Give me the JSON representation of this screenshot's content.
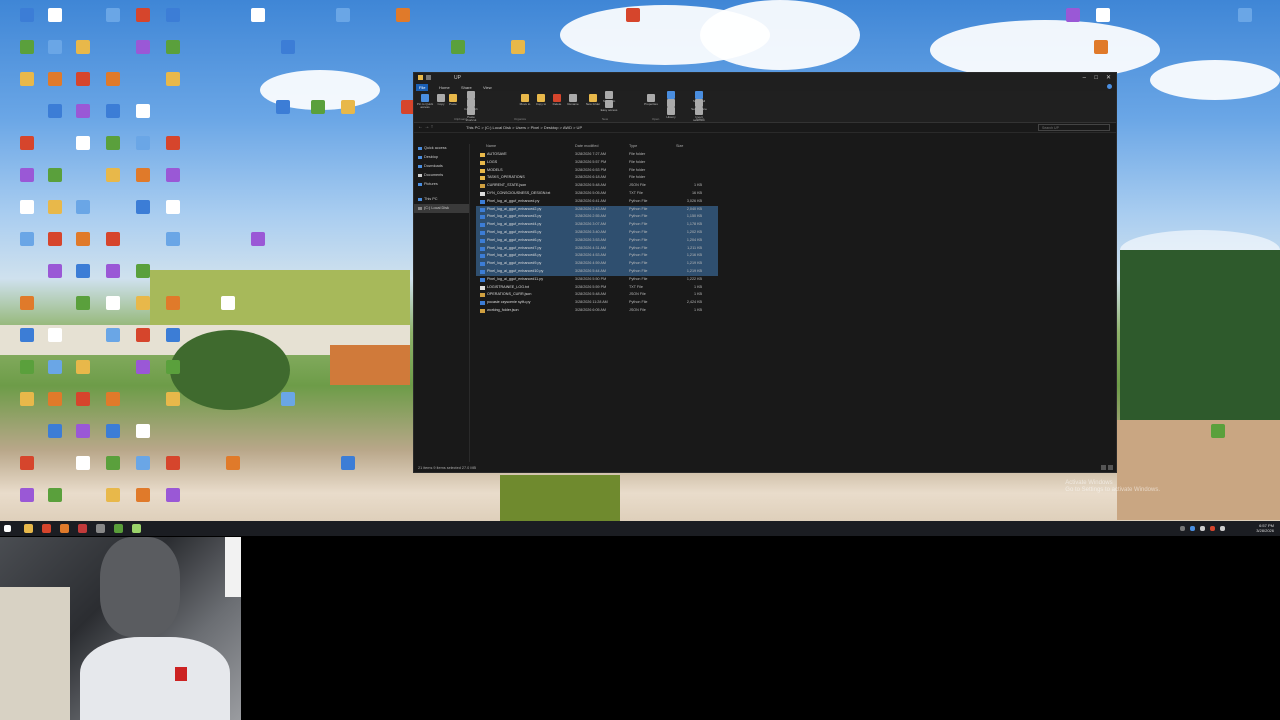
{
  "colors": {
    "explorer_bg": "#191919",
    "selection": "#2f4f6f",
    "ribbon_file_tab": "#1a5fb4",
    "folder": "#e8b84a",
    "python": "#3c7dd6",
    "text_file": "#dddddd",
    "json_file": "#d0a040",
    "taskbar": "#1b1d22"
  },
  "explorer": {
    "title": "UP",
    "tabs": [
      "File",
      "Home",
      "Share",
      "View"
    ],
    "ribbon": {
      "buttons": [
        {
          "label": "Pin to Quick access",
          "icon": "pin-icon"
        },
        {
          "label": "Copy",
          "icon": "copy-icon"
        },
        {
          "label": "Paste",
          "icon": "paste-icon"
        },
        {
          "label": "Cut",
          "icon": "cut-icon"
        },
        {
          "label": "Copy path",
          "icon": "path-icon"
        },
        {
          "label": "Paste shortcut",
          "icon": "shortcut-icon"
        },
        {
          "label": "Move to",
          "icon": "move-icon"
        },
        {
          "label": "Copy to",
          "icon": "copyto-icon"
        },
        {
          "label": "Delete",
          "icon": "delete-icon"
        },
        {
          "label": "Rename",
          "icon": "rename-icon"
        },
        {
          "label": "New folder",
          "icon": "newfolder-icon"
        },
        {
          "label": "New item",
          "icon": "newitem-icon"
        },
        {
          "label": "Easy access",
          "icon": "easyaccess-icon"
        },
        {
          "label": "Properties",
          "icon": "properties-icon"
        },
        {
          "label": "Open",
          "icon": "open-icon"
        },
        {
          "label": "Edit",
          "icon": "edit-icon"
        },
        {
          "label": "History",
          "icon": "history-icon"
        },
        {
          "label": "Select all",
          "icon": "selectall-icon"
        },
        {
          "label": "Select none",
          "icon": "selectnone-icon"
        },
        {
          "label": "Invert selection",
          "icon": "invert-icon"
        }
      ],
      "groups": [
        "Clipboard",
        "Organize",
        "New",
        "Open",
        "Select"
      ]
    },
    "address": {
      "crumbs": "This PC  >  (C:) Local Disk  >  Users  >  Pixel  >  Desktop  >  AWD  >  UP",
      "search_placeholder": "Search UP"
    },
    "nav_items": [
      {
        "label": "Quick access",
        "icon": "star-icon"
      },
      {
        "label": "Desktop",
        "icon": "desktop-icon"
      },
      {
        "label": "Downloads",
        "icon": "download-icon"
      },
      {
        "label": "Documents",
        "icon": "document-icon"
      },
      {
        "label": "Pictures",
        "icon": "picture-icon"
      },
      {
        "label": "This PC",
        "icon": "pc-icon"
      },
      {
        "label": "(C:) Local Disk",
        "icon": "disk-icon"
      }
    ],
    "columns": {
      "name": "Name",
      "date": "Date modified",
      "type": "Type",
      "size": "Size"
    },
    "files": [
      {
        "name": "AUTOSAVE",
        "date": "3/28/2026 7:27 AM",
        "type": "File folder",
        "size": "",
        "kind": "folder",
        "selected": false
      },
      {
        "name": "LOGS",
        "date": "3/28/2026 5:57 PM",
        "type": "File folder",
        "size": "",
        "kind": "folder",
        "selected": false
      },
      {
        "name": "MODELS",
        "date": "3/28/2026 6:53 PM",
        "type": "File folder",
        "size": "",
        "kind": "folder",
        "selected": false
      },
      {
        "name": "TASKS_OPERATIONS",
        "date": "3/28/2026 6:18 AM",
        "type": "File folder",
        "size": "",
        "kind": "folder",
        "selected": false
      },
      {
        "name": "CURRENT_STATE.json",
        "date": "3/28/2026 5:48 AM",
        "type": "JSON File",
        "size": "1 KB",
        "kind": "json",
        "selected": false
      },
      {
        "name": "DYN_CONSCIOUSNESS_DESIGN.txt",
        "date": "3/28/2026 5:05 AM",
        "type": "TXT File",
        "size": "16 KB",
        "kind": "txt",
        "selected": false
      },
      {
        "name": "Pixel_log_ai_gguf_enhanced.py",
        "date": "3/28/2026 6:41 AM",
        "type": "Python File",
        "size": "3,026 KB",
        "kind": "py",
        "selected": false
      },
      {
        "name": "Pixel_log_ai_gguf_enhanced2.py",
        "date": "3/28/2026 2:43 AM",
        "type": "Python File",
        "size": "2,040 KB",
        "kind": "py",
        "selected": true
      },
      {
        "name": "Pixel_log_ai_gguf_enhanced3.py",
        "date": "3/28/2026 2:55 AM",
        "type": "Python File",
        "size": "1,150 KB",
        "kind": "py",
        "selected": true
      },
      {
        "name": "Pixel_log_ai_gguf_enhanced4.py",
        "date": "3/28/2026 3:07 AM",
        "type": "Python File",
        "size": "1,178 KB",
        "kind": "py",
        "selected": true
      },
      {
        "name": "Pixel_log_ai_gguf_enhanced5.py",
        "date": "3/28/2026 3:40 AM",
        "type": "Python File",
        "size": "1,202 KB",
        "kind": "py",
        "selected": true
      },
      {
        "name": "Pixel_log_ai_gguf_enhanced6.py",
        "date": "3/28/2026 3:53 AM",
        "type": "Python File",
        "size": "1,204 KB",
        "kind": "py",
        "selected": true
      },
      {
        "name": "Pixel_log_ai_gguf_enhanced7.py",
        "date": "3/28/2026 4:31 AM",
        "type": "Python File",
        "size": "1,211 KB",
        "kind": "py",
        "selected": true
      },
      {
        "name": "Pixel_log_ai_gguf_enhanced8.py",
        "date": "3/28/2026 4:53 AM",
        "type": "Python File",
        "size": "1,216 KB",
        "kind": "py",
        "selected": true
      },
      {
        "name": "Pixel_log_ai_gguf_enhanced9.py",
        "date": "3/28/2026 4:59 AM",
        "type": "Python File",
        "size": "1,219 KB",
        "kind": "py",
        "selected": true
      },
      {
        "name": "Pixel_log_ai_gguf_enhanced10.py",
        "date": "3/28/2026 5:44 AM",
        "type": "Python File",
        "size": "1,219 KB",
        "kind": "py",
        "selected": true
      },
      {
        "name": "Pixel_log_ai_gguf_enhanced11.py",
        "date": "3/28/2026 5:50 PM",
        "type": "Python File",
        "size": "1,222 KB",
        "kind": "py",
        "selected": false
      },
      {
        "name": "LOGISTRAINEE_LOG.txt",
        "date": "3/28/2026 5:59 PM",
        "type": "TXT File",
        "size": "1 KB",
        "kind": "txt",
        "selected": false
      },
      {
        "name": "OPERATIONS_CURR.json",
        "date": "3/28/2026 5:48 AM",
        "type": "JSON File",
        "size": "1 KB",
        "kind": "json",
        "selected": false
      },
      {
        "name": "pocasie czyscenie sylfu.py",
        "date": "3/28/2026 11:28 AM",
        "type": "Python File",
        "size": "2,424 KB",
        "kind": "py",
        "selected": false
      },
      {
        "name": "working_folder.json",
        "date": "3/28/2026 6:05 AM",
        "type": "JSON File",
        "size": "1 KB",
        "kind": "json",
        "selected": false
      }
    ],
    "status": "21 items   9 items selected  27.0 MB"
  },
  "desktop": {
    "watermark": "Activate Windows\nGo to Settings to activate Windows."
  },
  "taskbar": {
    "clock_time": "6:57 PM",
    "clock_date": "3/28/2026"
  }
}
